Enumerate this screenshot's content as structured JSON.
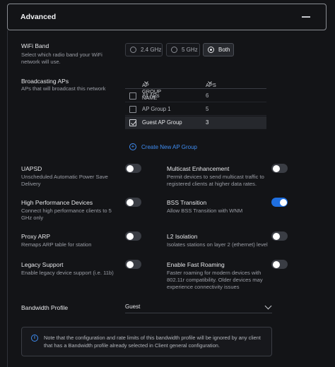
{
  "header": {
    "title": "Advanced"
  },
  "wifi_band": {
    "label": "WiFi Band",
    "desc": "Select which radio band your WiFi network will use.",
    "options": [
      {
        "label": "2.4 GHz",
        "selected": false
      },
      {
        "label": "5 GHz",
        "selected": false
      },
      {
        "label": "Both",
        "selected": true
      }
    ]
  },
  "broadcasting": {
    "label": "Broadcasting APs",
    "desc": "APs that will broadcast this network",
    "columns": {
      "group": "AP GROUP NAME",
      "aps": "APS"
    },
    "rows": [
      {
        "name": "All APs",
        "aps": "6",
        "checked": false
      },
      {
        "name": "AP Group 1",
        "aps": "5",
        "checked": false
      },
      {
        "name": "Guest AP Group",
        "aps": "3",
        "checked": true
      }
    ],
    "create_label": "Create New AP Group"
  },
  "settings": {
    "uapsd": {
      "label": "UAPSD",
      "desc": "Unscheduled Automatic Power Save Delivery",
      "on": false
    },
    "multicast": {
      "label": "Multicast Enhancement",
      "desc": "Permit devices to send multicast traffic to registered clients at higher data rates.",
      "on": false
    },
    "high_perf": {
      "label": "High Performance Devices",
      "desc": "Connect high performance clients to 5 GHz only",
      "on": false
    },
    "bss": {
      "label": "BSS Transition",
      "desc": "Allow BSS Transition with WNM",
      "on": true
    },
    "proxy_arp": {
      "label": "Proxy ARP",
      "desc": "Remaps ARP table for station",
      "on": false
    },
    "l2": {
      "label": "L2 Isolation",
      "desc": "Isolates stations on layer 2 (ethernet) level",
      "on": false
    },
    "legacy": {
      "label": "Legacy Support",
      "desc": "Enable legacy device support (i.e. 11b)",
      "on": false
    },
    "fast_roaming": {
      "label": "Enable Fast Roaming",
      "desc": "Faster roaming for modern devices with 802.11r compatibility. Older devices may experience connectivity issues",
      "on": false
    }
  },
  "bandwidth": {
    "label": "Bandwidth Profile",
    "value": "Guest"
  },
  "note": "Note that the configuration and rate limits of this bandwidth profile will be ignored by any client that has a Bandwidth profile already selected in Client general configuration.",
  "colors": {
    "accent": "#1f6fe0",
    "link": "#3f8df2",
    "background": "#131417"
  }
}
